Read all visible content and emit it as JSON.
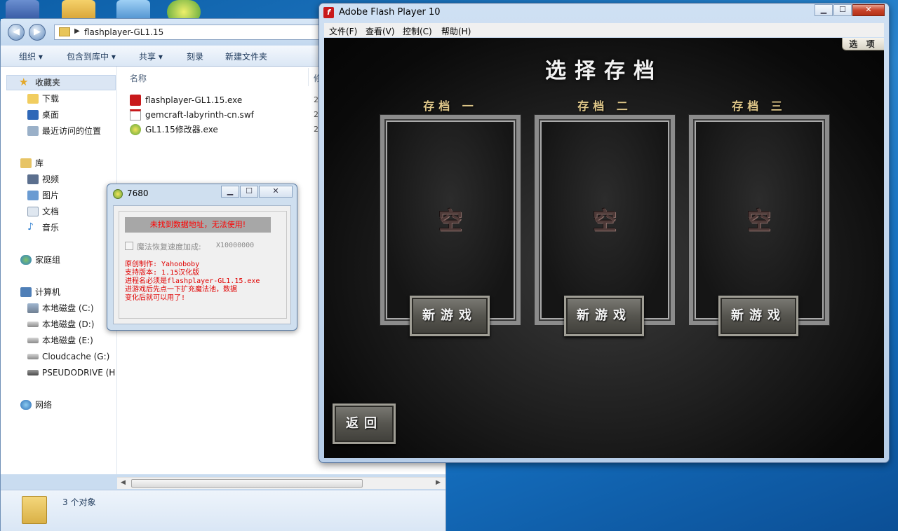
{
  "desktop": {
    "background_color": "#1a6fc0"
  },
  "explorer": {
    "address": "flashplayer-GL1.15",
    "toolbar": [
      "组织 ▾",
      "包含到库中 ▾",
      "共享 ▾",
      "刻录",
      "新建文件夹"
    ],
    "nav": {
      "favorites": "收藏夹",
      "downloads": "下载",
      "desktop": "桌面",
      "recent": "最近访问的位置",
      "libraries": "库",
      "videos": "视频",
      "pictures": "图片",
      "documents": "文档",
      "music": "音乐",
      "homegroup": "家庭组",
      "computer": "计算机",
      "drive_c": "本地磁盘 (C:)",
      "drive_d": "本地磁盘 (D:)",
      "drive_e": "本地磁盘 (E:)",
      "drive_g": "Cloudcache (G:)",
      "drive_h": "PSEUDODRIVE (H:",
      "network": "网络"
    },
    "columns": {
      "name": "名称",
      "next": "修"
    },
    "files": [
      {
        "name": "flashplayer-GL1.15.exe",
        "date": "2",
        "icon": "flash-exe-icon"
      },
      {
        "name": "gemcraft-labyrinth-cn.swf",
        "date": "2",
        "icon": "swf-file-icon"
      },
      {
        "name": "GL1.15修改器.exe",
        "date": "2",
        "icon": "trainer-exe-icon"
      }
    ],
    "status": "3 个对象"
  },
  "trainer": {
    "title": "7680",
    "banner": "未找到数据地址，无法使用!",
    "option_label": "魔法恢复速度加成:",
    "option_value": "X10000000",
    "info_lines": [
      "原创制作: Yahooboby",
      "支持版本: 1.15汉化版",
      "进程名必须是flashplayer-GL1.15.exe",
      "进游戏后先点一下扩充魔法池，数据",
      "变化后就可以用了!"
    ]
  },
  "flash": {
    "title": "Adobe Flash Player 10",
    "menus": [
      "文件(F)",
      "查看(V)",
      "控制(C)",
      "帮助(H)"
    ],
    "options_label": "选 项",
    "heading": "选择存档",
    "slots": [
      {
        "title": "存档 一",
        "state": "空",
        "button": "新游戏"
      },
      {
        "title": "存档 二",
        "state": "空",
        "button": "新游戏"
      },
      {
        "title": "存档 三",
        "state": "空",
        "button": "新游戏"
      }
    ],
    "back": "返回"
  }
}
